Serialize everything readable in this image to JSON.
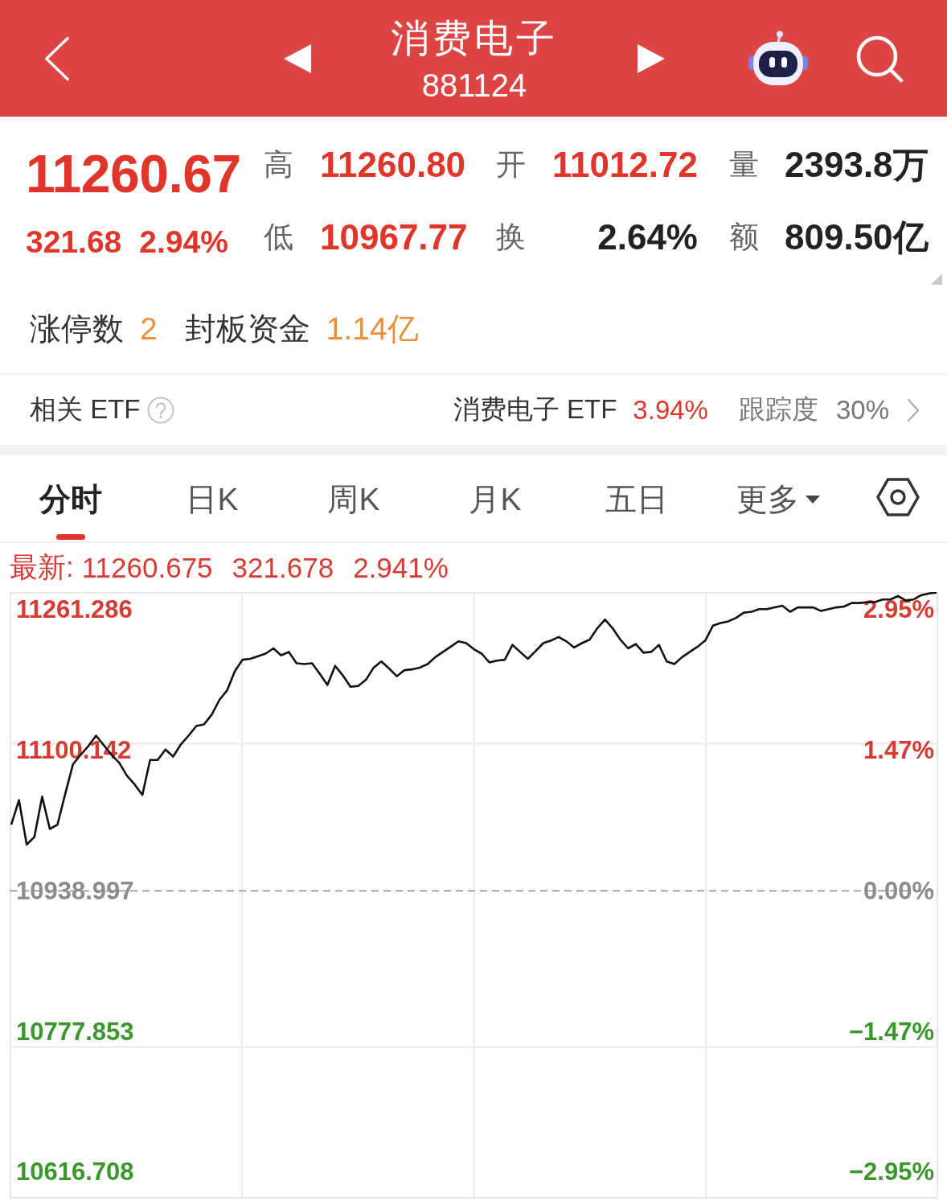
{
  "header": {
    "title": "消费电子",
    "code": "881124"
  },
  "quote": {
    "price": "11260.67",
    "change": "321.68",
    "percent": "2.94%",
    "stats": [
      {
        "label": "高",
        "value": "11260.80",
        "kind": "up"
      },
      {
        "label": "开",
        "value": "11012.72",
        "kind": "up"
      },
      {
        "label": "量",
        "value": "2393.8万",
        "kind": "plain"
      },
      {
        "label": "低",
        "value": "10967.77",
        "kind": "up"
      },
      {
        "label": "换",
        "value": "2.64%",
        "kind": "plain"
      },
      {
        "label": "额",
        "value": "809.50亿",
        "kind": "plain"
      }
    ]
  },
  "limit_up": {
    "count_label": "涨停数",
    "count": "2",
    "funds_label": "封板资金",
    "funds": "1.14亿"
  },
  "etf": {
    "label": "相关 ETF",
    "name": "消费电子 ETF",
    "change": "3.94%",
    "tracking_label": "跟踪度",
    "tracking": "30%"
  },
  "tabs": [
    {
      "label": "分时",
      "kind": "view",
      "selected": true
    },
    {
      "label": "日K",
      "kind": "view",
      "selected": false
    },
    {
      "label": "周K",
      "kind": "view",
      "selected": false
    },
    {
      "label": "月K",
      "kind": "view",
      "selected": false
    },
    {
      "label": "五日",
      "kind": "view",
      "selected": false
    },
    {
      "label": "更多",
      "kind": "menu",
      "selected": false
    }
  ],
  "chart": {
    "latest": {
      "label": "最新:",
      "price": "11260.675",
      "change": "321.678",
      "percent": "2.941%"
    },
    "right_labels": [
      "2.95%",
      "1.47%",
      "0.00%",
      "−1.47%",
      "−2.95%"
    ],
    "chart_data": {
      "type": "line",
      "ylim": [
        10586.277,
        11281.573
      ],
      "yticks": [
        {
          "value": 11261.286,
          "label": "11261.286"
        },
        {
          "value": 11100.142,
          "label": "11100.142"
        },
        {
          "value": 10938.997,
          "label": "10938.997"
        },
        {
          "value": 10777.853,
          "label": "10777.853"
        },
        {
          "value": 10616.708,
          "label": "10616.708"
        }
      ],
      "ref_lines": [
        {
          "axis": "y",
          "value": 10938.997
        }
      ],
      "series": [
        {
          "color": "#111111",
          "values": [
            11015,
            11043,
            10992,
            11001,
            11047,
            11010,
            11015,
            11050,
            11084,
            11095,
            11105,
            11117,
            11106,
            11095,
            11086,
            11071,
            11061,
            11049,
            11089,
            11089,
            11101,
            11093,
            11107,
            11117,
            11128,
            11130,
            11141,
            11158,
            11169,
            11191,
            11204,
            11205,
            11208,
            11211,
            11217,
            11209,
            11213,
            11200,
            11199,
            11200,
            11188,
            11175,
            11197,
            11186,
            11173,
            11174,
            11181,
            11195,
            11202,
            11194,
            11185,
            11192,
            11193,
            11195,
            11199,
            11207,
            11213,
            11219,
            11225,
            11223,
            11216,
            11211,
            11201,
            11203,
            11204,
            11221,
            11213,
            11205,
            11214,
            11223,
            11226,
            11230,
            11225,
            11218,
            11223,
            11227,
            11240,
            11250,
            11240,
            11227,
            11217,
            11222,
            11212,
            11213,
            11221,
            11202,
            11199,
            11207,
            11213,
            11219,
            11226,
            11243,
            11246,
            11248,
            11252,
            11258,
            11259,
            11262,
            11262,
            11264,
            11266,
            11259,
            11264,
            11264,
            11264,
            11260,
            11262,
            11264,
            11265,
            11269,
            11269,
            11270,
            11270,
            11273,
            11273,
            11277,
            11272,
            11273,
            11278,
            11280,
            11281
          ]
        }
      ]
    }
  }
}
